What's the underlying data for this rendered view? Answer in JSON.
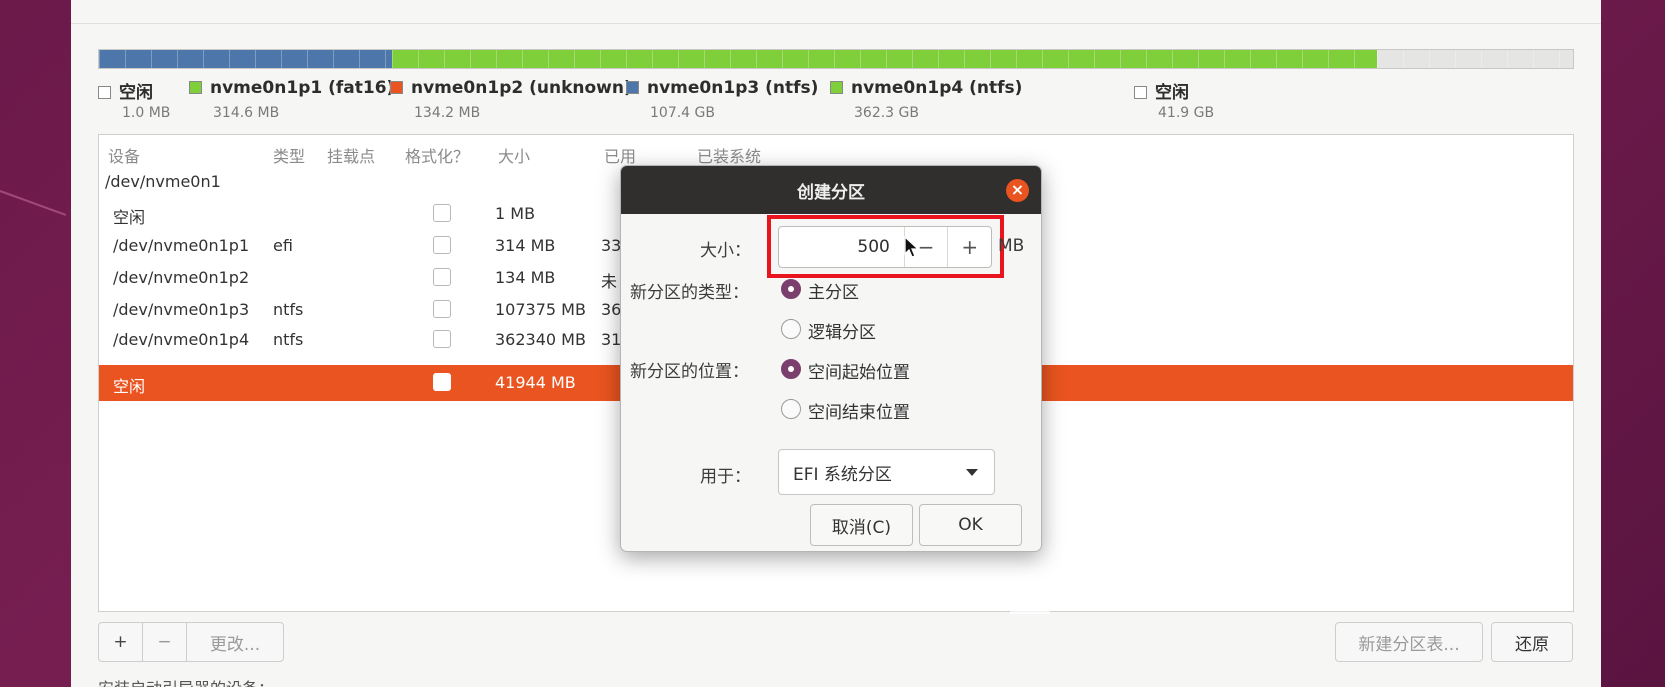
{
  "colors": {
    "accent": "#e95420",
    "blue": "#4d77ab",
    "green": "#7fcf3b",
    "orange": "#e95420",
    "free": "#ffffff"
  },
  "legend": [
    {
      "name": "空闲",
      "size": "1.0 MB",
      "color": "free"
    },
    {
      "name": "nvme0n1p1 (fat16)",
      "size": "314.6 MB",
      "color": "green"
    },
    {
      "name": "nvme0n1p2 (unknown)",
      "size": "134.2 MB",
      "color": "orange"
    },
    {
      "name": "nvme0n1p3 (ntfs)",
      "size": "107.4 GB",
      "color": "blue"
    },
    {
      "name": "nvme0n1p4 (ntfs)",
      "size": "362.3 GB",
      "color": "green"
    },
    {
      "name": "空闲",
      "size": "41.9 GB",
      "color": "free"
    }
  ],
  "table": {
    "headers": [
      "设备",
      "类型",
      "挂载点",
      "格式化？",
      "大小",
      "已用",
      "已装系统"
    ],
    "disk": "/dev/nvme0n1",
    "rows": [
      {
        "device": "空闲",
        "type": "",
        "size": "1 MB",
        "used": ""
      },
      {
        "device": "/dev/nvme0n1p1",
        "type": "efi",
        "size": "314 MB",
        "used": "33"
      },
      {
        "device": "/dev/nvme0n1p2",
        "type": "",
        "size": "134 MB",
        "used": "未"
      },
      {
        "device": "/dev/nvme0n1p3",
        "type": "ntfs",
        "size": "107375 MB",
        "used": "36"
      },
      {
        "device": "/dev/nvme0n1p4",
        "type": "ntfs",
        "size": "362340 MB",
        "used": "31"
      },
      {
        "device": "空闲",
        "type": "",
        "size": "41944 MB",
        "used": "",
        "selected": true
      }
    ]
  },
  "bottom": {
    "add": "+",
    "remove": "−",
    "change": "更改...",
    "new_table": "新建分区表...",
    "revert": "还原",
    "boot_label": "安装启动引导器的设备："
  },
  "dialog": {
    "title": "创建分区",
    "close_icon": "close-icon",
    "size_label": "大小：",
    "size_value": "500",
    "minus": "−",
    "plus": "+",
    "unit": "MB",
    "type_label": "新分区的类型：",
    "type_primary": "主分区",
    "type_logical": "逻辑分区",
    "location_label": "新分区的位置：",
    "location_start": "空间起始位置",
    "location_end": "空间结束位置",
    "use_label": "用于：",
    "use_value": "EFI 系统分区",
    "cancel": "取消(C)",
    "ok": "OK"
  }
}
